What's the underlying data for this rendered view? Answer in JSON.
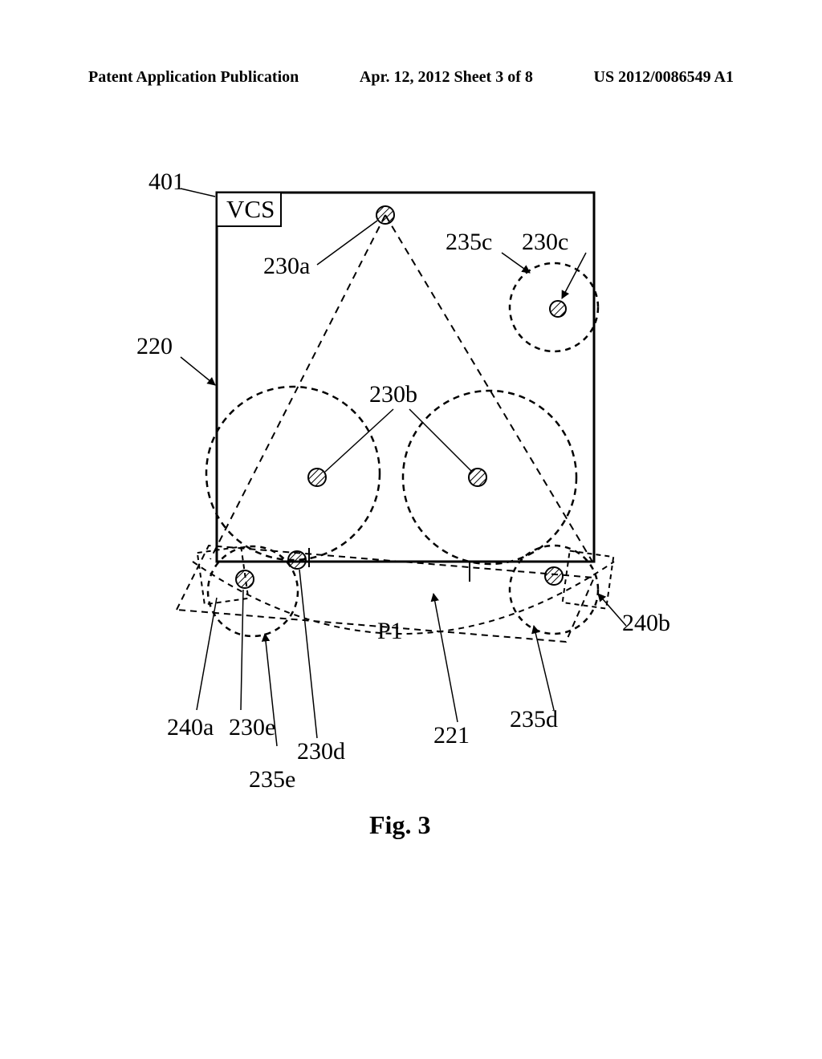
{
  "header": {
    "left": "Patent Application Publication",
    "center": "Apr. 12, 2012  Sheet 3 of 8",
    "right": "US 2012/0086549 A1"
  },
  "labels": {
    "l401": "401",
    "vcs": "VCS",
    "l230a": "230a",
    "l235c": "235c",
    "l230c": "230c",
    "l220": "220",
    "l230b": "230b",
    "P1": "P1",
    "l240b": "240b",
    "l235d": "235d",
    "l240a": "240a",
    "l230e": "230e",
    "l230d": "230d",
    "l221": "221",
    "l235e": "235e"
  },
  "figure_caption": "Fig. 3"
}
